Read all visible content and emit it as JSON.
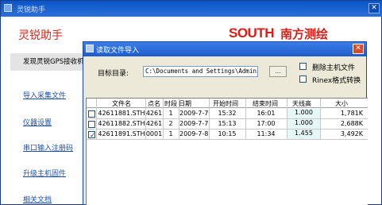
{
  "main_window": {
    "title": "灵锐助手",
    "brand": "灵锐助手",
    "logo_text": "SOUTH",
    "logo_cn": "南方测绘",
    "close_glyph": "✕"
  },
  "sidebar": {
    "header": "发现灵锐GPS接收机",
    "items": [
      {
        "label": "导入采集文件"
      },
      {
        "label": "仪器设置"
      },
      {
        "label": "串口输入注册码"
      },
      {
        "label": "升级主机固件"
      },
      {
        "label": "相关文档"
      }
    ]
  },
  "dialog": {
    "title": "读取文件导入",
    "close_glyph": "✕",
    "dir_label": "目标目录:",
    "dir_value": "C:\\Documents and Settings\\Administ",
    "browse_label": "...",
    "options": [
      {
        "label": "删除主机文件",
        "checked": false
      },
      {
        "label": "Rinex格式转换",
        "checked": false
      }
    ],
    "table": {
      "columns": [
        "文件名",
        "点名",
        "时段",
        "日期",
        "开始时间",
        "结束时间",
        "天线高",
        "大小"
      ],
      "rows": [
        {
          "checked": false,
          "file": "42611881.STH",
          "point": "4261",
          "session": "1",
          "date": "2009-7-7",
          "start": "15:32",
          "end": "16:01",
          "antenna": "1.000",
          "size": "1,781K"
        },
        {
          "checked": false,
          "file": "42611882.STH",
          "point": "4261",
          "session": "2",
          "date": "2009-7-7",
          "start": "15:13",
          "end": "17:00",
          "antenna": "1.000",
          "size": "2,688K"
        },
        {
          "checked": true,
          "file": "42611891.STH",
          "point": "0001",
          "session": "1",
          "date": "2009-7-8",
          "start": "10:15",
          "end": "11:34",
          "antenna": "1.455",
          "size": "3,492K"
        }
      ]
    }
  },
  "colors": {
    "brand_red": "#d22a1e",
    "link_blue": "#1d50a8",
    "titlebar_blue": "#0a56c8"
  }
}
